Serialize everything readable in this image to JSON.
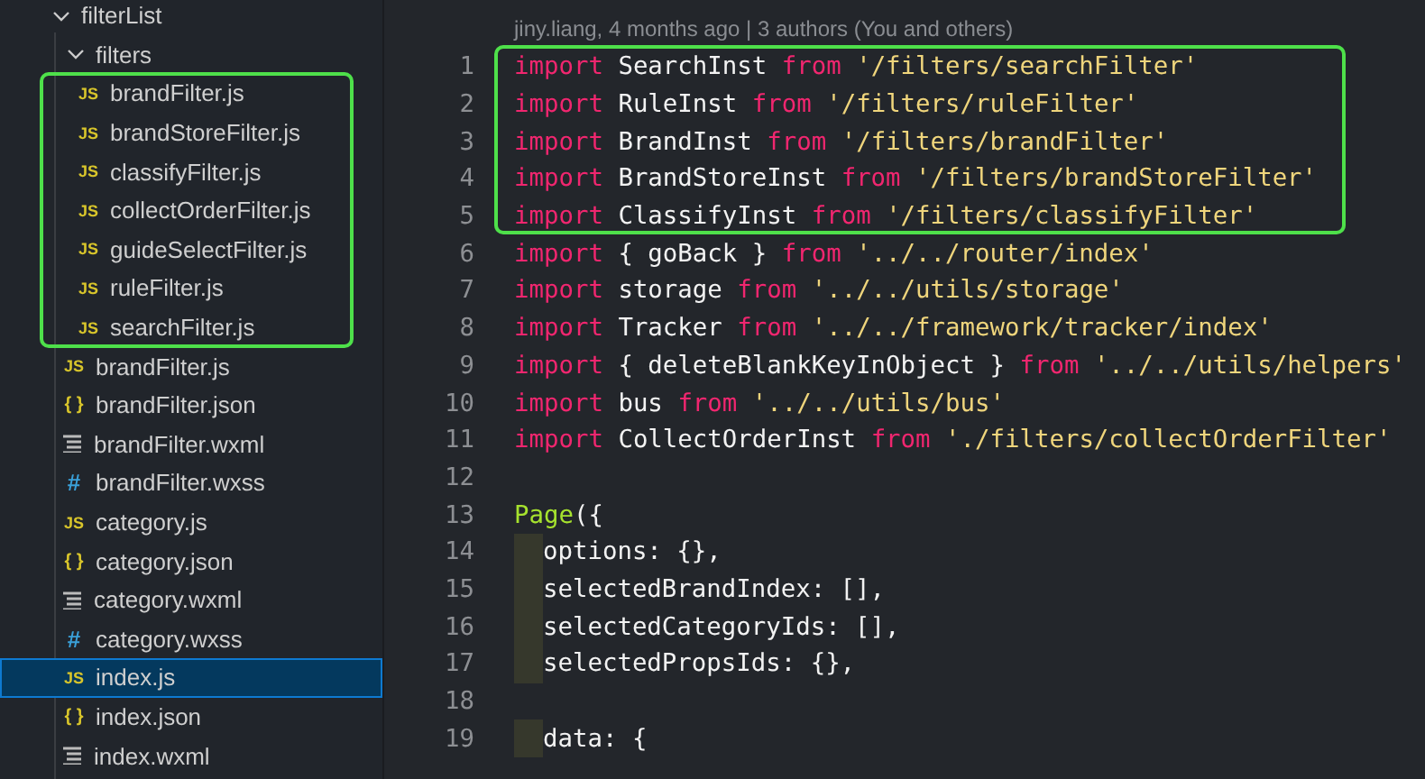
{
  "explorer": {
    "items": [
      {
        "label": "filterList",
        "kind": "folder",
        "expanded": true,
        "selected": false,
        "children": [
          {
            "label": "filters",
            "kind": "folder",
            "expanded": true,
            "selected": false,
            "boxed": true,
            "children": [
              {
                "label": "brandFilter.js",
                "kind": "js",
                "icon": "JS",
                "selected": false
              },
              {
                "label": "brandStoreFilter.js",
                "kind": "js",
                "icon": "JS",
                "selected": false
              },
              {
                "label": "classifyFilter.js",
                "kind": "js",
                "icon": "JS",
                "selected": false
              },
              {
                "label": "collectOrderFilter.js",
                "kind": "js",
                "icon": "JS",
                "selected": false
              },
              {
                "label": "guideSelectFilter.js",
                "kind": "js",
                "icon": "JS",
                "selected": false
              },
              {
                "label": "ruleFilter.js",
                "kind": "js",
                "icon": "JS",
                "selected": false
              },
              {
                "label": "searchFilter.js",
                "kind": "js",
                "icon": "JS",
                "selected": false
              }
            ]
          },
          {
            "label": "brandFilter.js",
            "kind": "js",
            "icon": "JS",
            "selected": false
          },
          {
            "label": "brandFilter.json",
            "kind": "json",
            "icon": "{ }",
            "selected": false
          },
          {
            "label": "brandFilter.wxml",
            "kind": "wxml",
            "selected": false
          },
          {
            "label": "brandFilter.wxss",
            "kind": "wxss",
            "icon": "#",
            "selected": false
          },
          {
            "label": "category.js",
            "kind": "js",
            "icon": "JS",
            "selected": false
          },
          {
            "label": "category.json",
            "kind": "json",
            "icon": "{ }",
            "selected": false
          },
          {
            "label": "category.wxml",
            "kind": "wxml",
            "selected": false
          },
          {
            "label": "category.wxss",
            "kind": "wxss",
            "icon": "#",
            "selected": false
          },
          {
            "label": "index.js",
            "kind": "js",
            "icon": "JS",
            "selected": true
          },
          {
            "label": "index.json",
            "kind": "json",
            "icon": "{ }",
            "selected": false
          },
          {
            "label": "index.wxml",
            "kind": "wxml",
            "selected": false
          }
        ]
      }
    ]
  },
  "editor": {
    "blame": "jiny.liang, 4 months ago | 3 authors (You and others)",
    "lines": [
      {
        "number": "1",
        "boxed": true,
        "indented": false,
        "tokens": [
          {
            "kind": "keyword",
            "text": "import"
          },
          {
            "kind": "ident",
            "text": "SearchInst"
          },
          {
            "kind": "keyword",
            "text": "from"
          },
          {
            "kind": "string",
            "text": "'/filters/searchFilter'"
          }
        ]
      },
      {
        "number": "2",
        "boxed": true,
        "indented": false,
        "tokens": [
          {
            "kind": "keyword",
            "text": "import"
          },
          {
            "kind": "ident",
            "text": "RuleInst"
          },
          {
            "kind": "keyword",
            "text": "from"
          },
          {
            "kind": "string",
            "text": "'/filters/ruleFilter'"
          }
        ]
      },
      {
        "number": "3",
        "boxed": true,
        "indented": false,
        "tokens": [
          {
            "kind": "keyword",
            "text": "import"
          },
          {
            "kind": "ident",
            "text": "BrandInst"
          },
          {
            "kind": "keyword",
            "text": "from"
          },
          {
            "kind": "string",
            "text": "'/filters/brandFilter'"
          }
        ]
      },
      {
        "number": "4",
        "boxed": true,
        "indented": false,
        "tokens": [
          {
            "kind": "keyword",
            "text": "import"
          },
          {
            "kind": "ident",
            "text": "BrandStoreInst"
          },
          {
            "kind": "keyword",
            "text": "from"
          },
          {
            "kind": "string",
            "text": "'/filters/brandStoreFilter'"
          }
        ]
      },
      {
        "number": "5",
        "boxed": true,
        "indented": false,
        "tokens": [
          {
            "kind": "keyword",
            "text": "import"
          },
          {
            "kind": "ident",
            "text": "ClassifyInst"
          },
          {
            "kind": "keyword",
            "text": "from"
          },
          {
            "kind": "string",
            "text": "'/filters/classifyFilter'"
          }
        ]
      },
      {
        "number": "6",
        "boxed": false,
        "indented": false,
        "tokens": [
          {
            "kind": "keyword",
            "text": "import"
          },
          {
            "kind": "ident",
            "text": "{ goBack }"
          },
          {
            "kind": "keyword",
            "text": "from"
          },
          {
            "kind": "string",
            "text": "'../../router/index'"
          }
        ]
      },
      {
        "number": "7",
        "boxed": false,
        "indented": false,
        "tokens": [
          {
            "kind": "keyword",
            "text": "import"
          },
          {
            "kind": "ident",
            "text": "storage"
          },
          {
            "kind": "keyword",
            "text": "from"
          },
          {
            "kind": "string",
            "text": "'../../utils/storage'"
          }
        ]
      },
      {
        "number": "8",
        "boxed": false,
        "indented": false,
        "tokens": [
          {
            "kind": "keyword",
            "text": "import"
          },
          {
            "kind": "ident",
            "text": "Tracker"
          },
          {
            "kind": "keyword",
            "text": "from"
          },
          {
            "kind": "string",
            "text": "'../../framework/tracker/index'"
          }
        ]
      },
      {
        "number": "9",
        "boxed": false,
        "indented": false,
        "tokens": [
          {
            "kind": "keyword",
            "text": "import"
          },
          {
            "kind": "ident",
            "text": "{ deleteBlankKeyInObject }"
          },
          {
            "kind": "keyword",
            "text": "from"
          },
          {
            "kind": "string",
            "text": "'../../utils/helpers'"
          }
        ]
      },
      {
        "number": "10",
        "boxed": false,
        "indented": false,
        "tokens": [
          {
            "kind": "keyword",
            "text": "import"
          },
          {
            "kind": "ident",
            "text": "bus"
          },
          {
            "kind": "keyword",
            "text": "from"
          },
          {
            "kind": "string",
            "text": "'../../utils/bus'"
          }
        ]
      },
      {
        "number": "11",
        "boxed": false,
        "indented": false,
        "tokens": [
          {
            "kind": "keyword",
            "text": "import"
          },
          {
            "kind": "ident",
            "text": "CollectOrderInst"
          },
          {
            "kind": "keyword",
            "text": "from"
          },
          {
            "kind": "string",
            "text": "'./filters/collectOrderFilter'"
          }
        ]
      },
      {
        "number": "12",
        "boxed": false,
        "indented": false
      },
      {
        "number": "13",
        "boxed": false,
        "indented": false,
        "tokens": [
          {
            "kind": "func",
            "text": "Page"
          },
          {
            "kind": "ident",
            "text": "({"
          }
        ]
      },
      {
        "number": "14",
        "boxed": false,
        "indented": true,
        "tokens": [
          {
            "kind": "ident",
            "text": "options: {},"
          }
        ]
      },
      {
        "number": "15",
        "boxed": false,
        "indented": true,
        "tokens": [
          {
            "kind": "ident",
            "text": "selectedBrandIndex: [],"
          }
        ]
      },
      {
        "number": "16",
        "boxed": false,
        "indented": true,
        "tokens": [
          {
            "kind": "ident",
            "text": "selectedCategoryIds: [],"
          }
        ]
      },
      {
        "number": "17",
        "boxed": false,
        "indented": true,
        "tokens": [
          {
            "kind": "ident",
            "text": "selectedPropsIds: {},"
          }
        ]
      },
      {
        "number": "18",
        "boxed": false,
        "indented": false
      },
      {
        "number": "19",
        "boxed": false,
        "indented": true,
        "tokens": [
          {
            "kind": "ident",
            "text": "data: {"
          }
        ]
      }
    ]
  }
}
